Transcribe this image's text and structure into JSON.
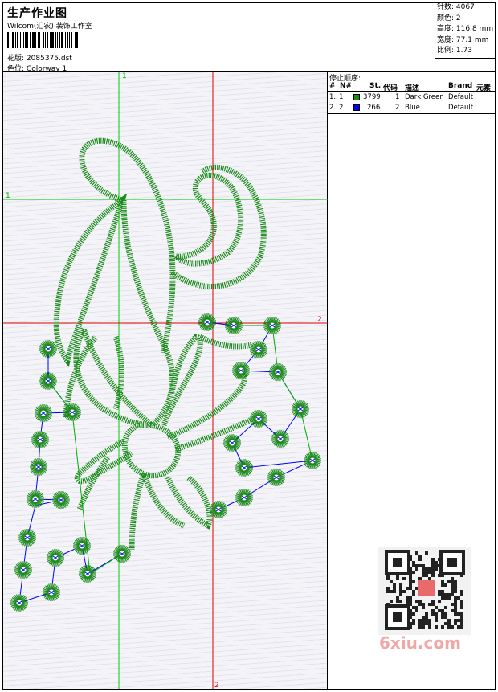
{
  "header": {
    "title": "生产作业图",
    "company": "Wilcom(汇农) 装饰工作室",
    "design_label": "花版:",
    "design_value": "2085375.dst",
    "colorway_label": "色位:",
    "colorway_value": "Colorway 1"
  },
  "stats": [
    {
      "label": "针数:",
      "value": "4067"
    },
    {
      "label": "颜色:",
      "value": "2"
    },
    {
      "label": "高度:",
      "value": "116.8 mm"
    },
    {
      "label": "宽度:",
      "value": "77.1 mm"
    },
    {
      "label": "比例:",
      "value": "1.73"
    }
  ],
  "stop_sequence": {
    "title": "停止顺序:",
    "columns": [
      "#",
      "N#",
      "St.",
      "代码",
      "描述",
      "Brand",
      "元素"
    ],
    "rows": [
      {
        "index": "1.",
        "n": "1",
        "stitches": "3799",
        "code": "1",
        "desc": "Dark Green",
        "brand": "Default",
        "color": "#1a8a1a"
      },
      {
        "index": "2.",
        "n": "2",
        "stitches": "266",
        "code": "2",
        "desc": "Blue",
        "brand": "Default",
        "color": "#0000ff"
      }
    ]
  },
  "guides": {
    "green_top": "1",
    "green_left": "1",
    "red_right": "2",
    "red_bottom": "2"
  },
  "watermark": "6xiu.com",
  "colors": {
    "thread_green": "#1a8a1a",
    "thread_blue": "#0000ff",
    "guide_green": "#00cc00",
    "guide_red": "#dd0000"
  }
}
